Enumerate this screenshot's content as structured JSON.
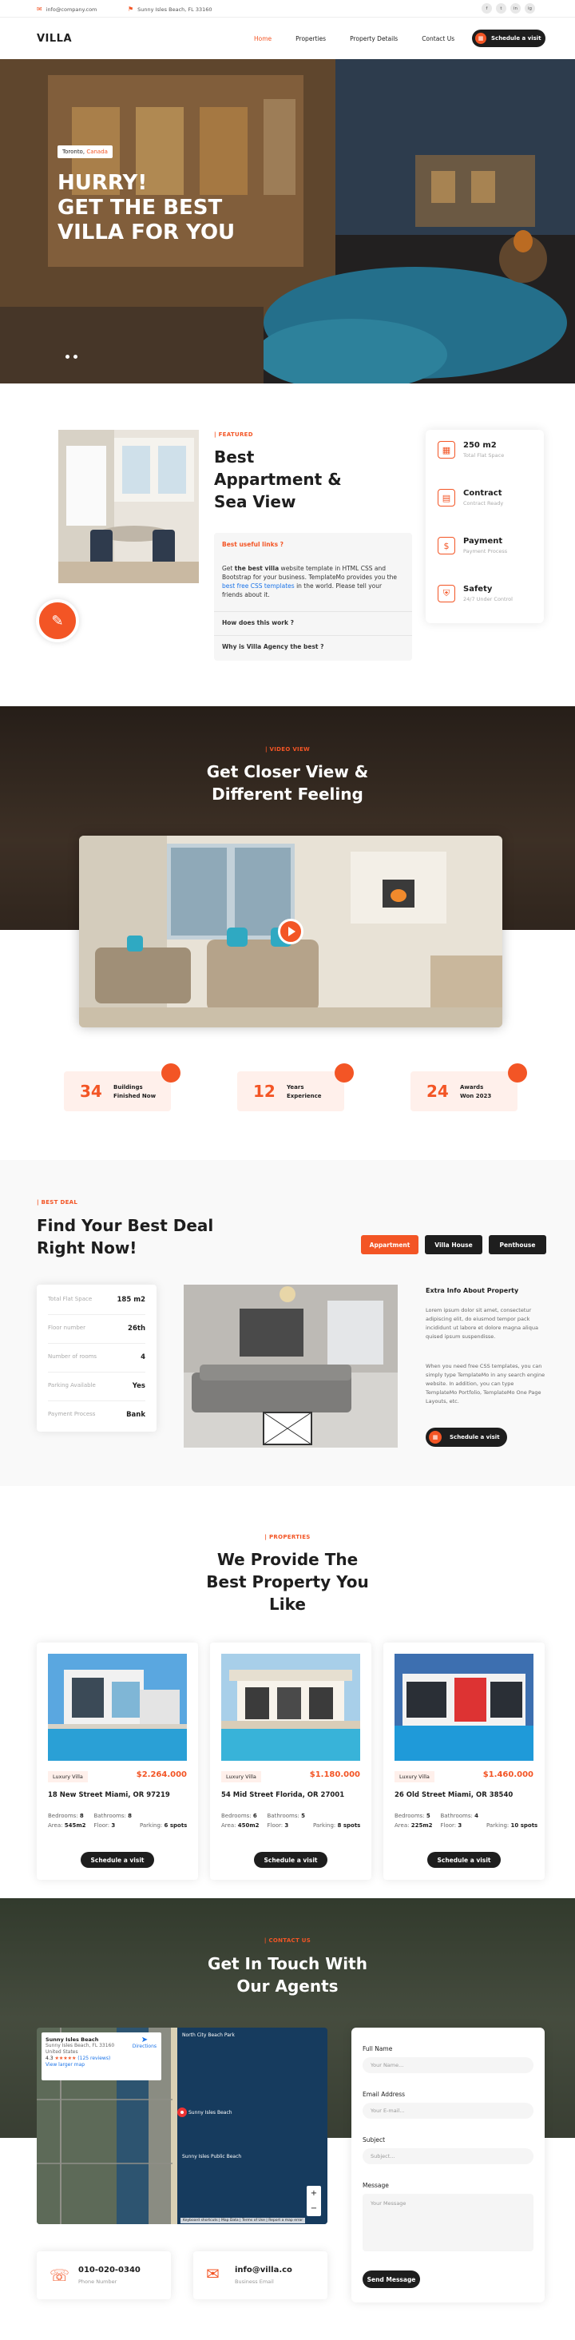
{
  "topbar": {
    "email": "info@company.com",
    "address": "Sunny Isles Beach, FL 33160",
    "social": [
      "f",
      "t",
      "in",
      "ig"
    ]
  },
  "header": {
    "logo": "VILLA",
    "nav": [
      "Home",
      "Properties",
      "Property Details",
      "Contact Us"
    ],
    "cta": "Schedule a visit"
  },
  "hero": {
    "location_city": "Toronto,",
    "location_country": "Canada",
    "title_line1": "HURRY!",
    "title_line2": "GET THE BEST",
    "title_line3": "VILLA FOR YOU"
  },
  "featured": {
    "kicker": "FEATURED",
    "title_line1": "Best",
    "title_line2": "Appartment &",
    "title_line3": "Sea View",
    "faq": [
      {
        "q": "Best useful links ?",
        "a_pre": "Get ",
        "a_bold": "the best villa",
        "a_mid": " website template in HTML CSS and Bootstrap for your business. TemplateMo provides you the ",
        "a_link": "best free CSS templates",
        "a_post": " in the world. Please tell your friends about it."
      },
      {
        "q": "How does this work ?"
      },
      {
        "q": "Why is Villa Agency the best ?"
      }
    ],
    "info": [
      {
        "title": "250 m2",
        "sub": "Total Flat Space"
      },
      {
        "title": "Contract",
        "sub": "Contract Ready"
      },
      {
        "title": "Payment",
        "sub": "Payment Process"
      },
      {
        "title": "Safety",
        "sub": "24/7 Under Control"
      }
    ]
  },
  "video": {
    "kicker": "VIDEO VIEW",
    "title_line1": "Get Closer View &",
    "title_line2": "Different Feeling"
  },
  "facts": [
    {
      "num": "34",
      "l1": "Buildings",
      "l2": "Finished Now"
    },
    {
      "num": "12",
      "l1": "Years",
      "l2": "Experience"
    },
    {
      "num": "24",
      "l1": "Awards",
      "l2": "Won 2023"
    }
  ],
  "deal": {
    "kicker": "BEST DEAL",
    "title_line1": "Find Your Best Deal",
    "title_line2": "Right Now!",
    "tabs": [
      "Appartment",
      "Villa House",
      "Penthouse"
    ],
    "specs": [
      {
        "label": "Total Flat Space",
        "value": "185 m2"
      },
      {
        "label": "Floor number",
        "value": "26th"
      },
      {
        "label": "Number of rooms",
        "value": "4"
      },
      {
        "label": "Parking Available",
        "value": "Yes"
      },
      {
        "label": "Payment Process",
        "value": "Bank"
      }
    ],
    "info_title": "Extra Info About Property",
    "p1": "Lorem ipsum dolor sit amet, consectetur adipiscing elit, do eiusmod tempor pack incididunt ut labore et dolore magna aliqua quised ipsum suspendisse.",
    "p2": "When you need free CSS templates, you can simply type TemplateMo in any search engine website. In addition, you can type TemplateMo Portfolio, TemplateMo One Page Layouts, etc.",
    "cta": "Schedule a visit"
  },
  "props": {
    "kicker": "PROPERTIES",
    "title_line1": "We Provide The",
    "title_line2": "Best Property You",
    "title_line3": "Like",
    "labels": {
      "bedrooms": "Bedrooms:",
      "bathrooms": "Bathrooms:",
      "area": "Area:",
      "floor": "Floor:",
      "parking": "Parking:"
    },
    "items": [
      {
        "tag": "Luxury Villa",
        "price": "$2.264.000",
        "title": "18 New Street Miami, OR 97219",
        "bed": "8",
        "bath": "8",
        "area": "545m2",
        "floor": "3",
        "park": "6 spots",
        "cta": "Schedule a visit"
      },
      {
        "tag": "Luxury Villa",
        "price": "$1.180.000",
        "title": "54 Mid Street Florida, OR 27001",
        "bed": "6",
        "bath": "5",
        "area": "450m2",
        "floor": "3",
        "park": "8 spots",
        "cta": "Schedule a visit"
      },
      {
        "tag": "Luxury Villa",
        "price": "$1.460.000",
        "title": "26 Old Street Miami, OR 38540",
        "bed": "5",
        "bath": "4",
        "area": "225m2",
        "floor": "3",
        "park": "10 spots",
        "cta": "Schedule a visit"
      }
    ]
  },
  "contact": {
    "kicker": "CONTACT US",
    "title_line1": "Get In Touch With",
    "title_line2": "Our Agents",
    "map": {
      "place": "Sunny Isles Beach",
      "addr": "Sunny Isles Beach, FL 33160 United States",
      "rating": "4.3",
      "reviews": "(125 reviews)",
      "link": "View larger map",
      "directions": "Directions",
      "label_north": "North City Beach Park",
      "label_center": "Sunny Isles Beach",
      "label_public": "Sunny Isles Public Beach",
      "footer": "Keyboard shortcuts | Map Data | Terms of Use | Report a map error"
    },
    "phone": {
      "value": "010-020-0340",
      "label": "Phone Number"
    },
    "email": {
      "value": "info@villa.co",
      "label": "Business Email"
    },
    "form": {
      "name_label": "Full Name",
      "name_ph": "Your Name...",
      "email_label": "Email Address",
      "email_ph": "Your E-mail...",
      "subject_label": "Subject",
      "subject_ph": "Subject...",
      "msg_label": "Message",
      "msg_ph": "Your Message",
      "submit": "Send Message"
    }
  }
}
